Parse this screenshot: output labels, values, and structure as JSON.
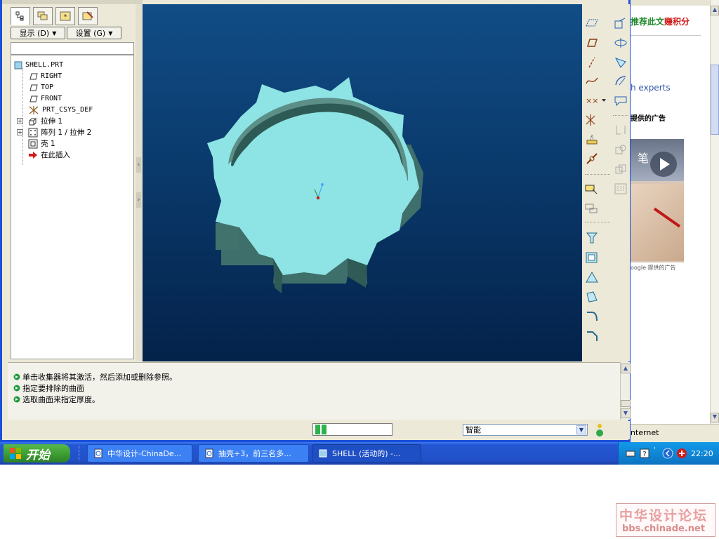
{
  "navigator": {
    "tabs": [
      "model-tree-icon",
      "layers-icon",
      "favorites-icon",
      "settings-tab-icon"
    ],
    "show_button": "显示 (D)",
    "settings_button": "设置 (G)",
    "tree": [
      {
        "label": "SHELL.PRT",
        "icon": "part-icon"
      },
      {
        "label": "RIGHT",
        "icon": "datum-plane-icon"
      },
      {
        "label": "TOP",
        "icon": "datum-plane-icon"
      },
      {
        "label": "FRONT",
        "icon": "datum-plane-icon"
      },
      {
        "label": "PRT_CSYS_DEF",
        "icon": "csys-icon"
      },
      {
        "label": "拉伸 1",
        "icon": "extrude-icon"
      },
      {
        "label": "阵列 1 / 拉伸 2",
        "icon": "pattern-icon"
      },
      {
        "label": "壳 1",
        "icon": "shell-icon"
      },
      {
        "label": "在此插入",
        "icon": "insert-here-icon"
      }
    ]
  },
  "messages": [
    "单击收集器将其激活，然后添加或删除参照。",
    "指定要排除的曲面",
    "选取曲面来指定厚度。"
  ],
  "status": {
    "filter_value": "智能"
  },
  "browser": {
    "ad_title_green": "推荐此文",
    "ad_title_red": "赚积分",
    "experts_text": "h experts",
    "ads_by": "提供的广告",
    "ad_image_text": "笔",
    "google_footer": "oogle 提供的广告",
    "status_text": "nternet"
  },
  "taskbar": {
    "start_label": "开始",
    "tasks": [
      {
        "label": "中华设计-ChinaDe..."
      },
      {
        "label": "抽壳+3，前三名多..."
      },
      {
        "label": "SHELL (活动的) -..."
      }
    ],
    "clock": "22:20"
  },
  "watermark": {
    "cn": "中华设计论坛",
    "url": "bbs.chinade.net"
  },
  "colors": {
    "viewport_top": "#114d86",
    "viewport_bottom": "#04224a",
    "model_face": "#8ee3e4",
    "model_side": "#3f6f6a",
    "window_border": "#1c4fd8"
  }
}
